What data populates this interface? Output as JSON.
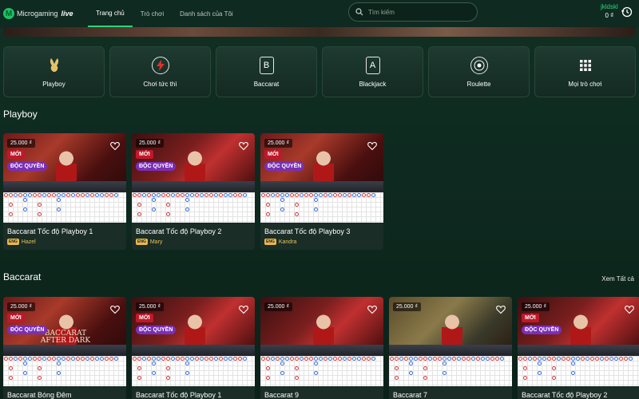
{
  "header": {
    "logo_text": "Microgaming",
    "logo_live": "live",
    "tabs": [
      {
        "label": "Trang chủ",
        "active": true
      },
      {
        "label": "Trò chơi",
        "active": false
      },
      {
        "label": "Danh sách của Tôi",
        "active": false
      }
    ],
    "search_placeholder": "Tìm kiếm",
    "user_name": "jkldskl",
    "balance": "0 ₫"
  },
  "categories": [
    {
      "label": "Playboy",
      "icon": "bunny-icon"
    },
    {
      "label": "Chơi tức thì",
      "icon": "lightning-icon"
    },
    {
      "label": "Baccarat",
      "icon": "cards-icon"
    },
    {
      "label": "Blackjack",
      "icon": "blackjack-icon"
    },
    {
      "label": "Roulette",
      "icon": "roulette-icon"
    },
    {
      "label": "Mọi trò chơi",
      "icon": "grid-icon"
    }
  ],
  "sections": {
    "playboy": {
      "title": "Playboy",
      "games": [
        {
          "bet": "25.000 ₫",
          "new": "MỚI",
          "exclusive": "ĐỘC QUYỀN",
          "title": "Baccarat Tốc độ Playboy 1",
          "lang": "ENG",
          "dealer": "Hazel"
        },
        {
          "bet": "25.000 ₫",
          "new": "MỚI",
          "exclusive": "ĐỘC QUYỀN",
          "title": "Baccarat Tốc độ Playboy 2",
          "lang": "ENG",
          "dealer": "Mary"
        },
        {
          "bet": "25.000 ₫",
          "new": "MỚI",
          "exclusive": "ĐỘC QUYỀN",
          "title": "Baccarat Tốc độ Playboy 3",
          "lang": "ENG",
          "dealer": "Kandra"
        }
      ]
    },
    "baccarat": {
      "title": "Baccarat",
      "see_all": "Xem Tất cả",
      "games": [
        {
          "bet": "25.000 ₫",
          "new": "MỚI",
          "exclusive": "ĐỘC QUYỀN",
          "title": "Baccarat Bóng Đêm",
          "overlay": "BACCARAT AFTER DARK"
        },
        {
          "bet": "25.000 ₫",
          "new": "MỚI",
          "exclusive": "ĐỘC QUYỀN",
          "title": "Baccarat Tốc độ Playboy 1"
        },
        {
          "bet": "25.000 ₫",
          "title": "Baccarat 9"
        },
        {
          "bet": "25.000 ₫",
          "title": "Baccarat 7"
        },
        {
          "bet": "25.000 ₫",
          "new": "MỚI",
          "exclusive": "ĐỘC QUYỀN",
          "title": "Baccarat Tốc độ Playboy 2"
        }
      ]
    }
  },
  "colors": {
    "accent": "#2dd47c",
    "new_badge": "#c0182a",
    "exclusive_badge": "#7a2fb8",
    "dealer_name": "#e8c45a"
  }
}
